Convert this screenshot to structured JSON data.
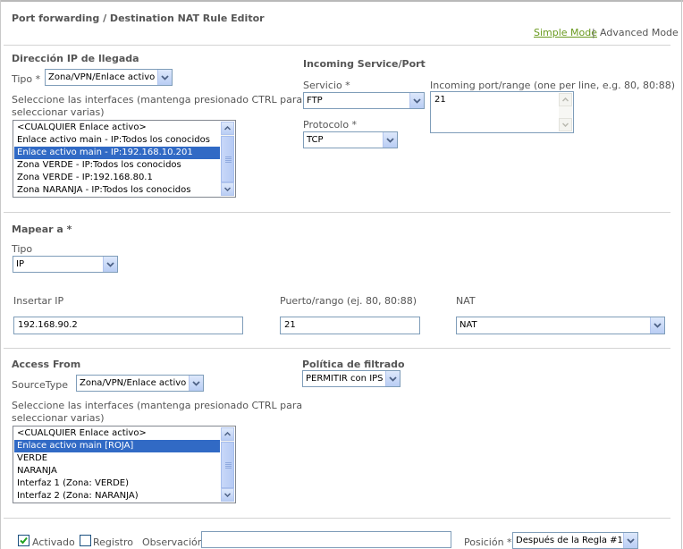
{
  "page": {
    "title": "Port forwarding / Destination NAT Rule Editor",
    "mode_simple": "Simple Mode",
    "mode_separator": "|",
    "mode_advanced": "Advanced Mode"
  },
  "incoming_ip": {
    "section_title": "Dirección IP de llegada",
    "type_label": "Tipo *",
    "type_value": "Zona/VPN/Enlace activo",
    "interfaces_hint_1": "Seleccione las interfaces (mantenga presionado CTRL para",
    "interfaces_hint_2": "seleccionar varias)",
    "interfaces": [
      {
        "label": "<CUALQUIER Enlace activo>",
        "selected": false
      },
      {
        "label": "Enlace activo main - IP:Todos los conocidos",
        "selected": false
      },
      {
        "label": "Enlace activo main - IP:192.168.10.201",
        "selected": true
      },
      {
        "label": "Zona VERDE - IP:Todos los conocidos",
        "selected": false
      },
      {
        "label": "Zona VERDE - IP:192.168.80.1",
        "selected": false
      },
      {
        "label": "Zona NARANJA - IP:Todos los conocidos",
        "selected": false
      }
    ]
  },
  "incoming_service": {
    "section_title": "Incoming Service/Port",
    "service_label": "Servicio *",
    "service_value": "FTP",
    "protocol_label": "Protocolo *",
    "protocol_value": "TCP",
    "port_label": "Incoming port/range (one per line, e.g. 80, 80:88)",
    "port_value": "21"
  },
  "map_to": {
    "section_title": "Mapear a *",
    "type_label": "Tipo",
    "type_value": "IP",
    "ip_label": "Insertar IP",
    "ip_value": "192.168.90.2",
    "port_label": "Puerto/rango (ej. 80, 80:88)",
    "port_value": "21",
    "nat_label": "NAT",
    "nat_value": "NAT"
  },
  "access_from": {
    "section_title": "Access From",
    "source_type_label": "SourceType",
    "source_type_value": "Zona/VPN/Enlace activo",
    "interfaces_hint_1": "Seleccione las interfaces (mantenga presionado CTRL para",
    "interfaces_hint_2": "seleccionar varias)",
    "interfaces": [
      {
        "label": "<CUALQUIER Enlace activo>",
        "selected": false
      },
      {
        "label": "Enlace activo main [ROJA]",
        "selected": true
      },
      {
        "label": "VERDE",
        "selected": false
      },
      {
        "label": "NARANJA",
        "selected": false
      },
      {
        "label": "Interfaz 1 (Zona: VERDE)",
        "selected": false
      },
      {
        "label": "Interfaz 2 (Zona: NARANJA)",
        "selected": false
      }
    ]
  },
  "filter_policy": {
    "section_title": "Política de filtrado",
    "value": "PERMITIR con IPS"
  },
  "footer": {
    "enabled_label": "Activado",
    "enabled_checked": true,
    "log_label": "Registro",
    "log_checked": false,
    "remark_label": "Observación",
    "remark_value": "",
    "position_label": "Posición *",
    "position_value": "Después de la Regla #1"
  },
  "colors": {
    "link_green": "#6a9a1f",
    "selection_blue": "#316ac5"
  }
}
